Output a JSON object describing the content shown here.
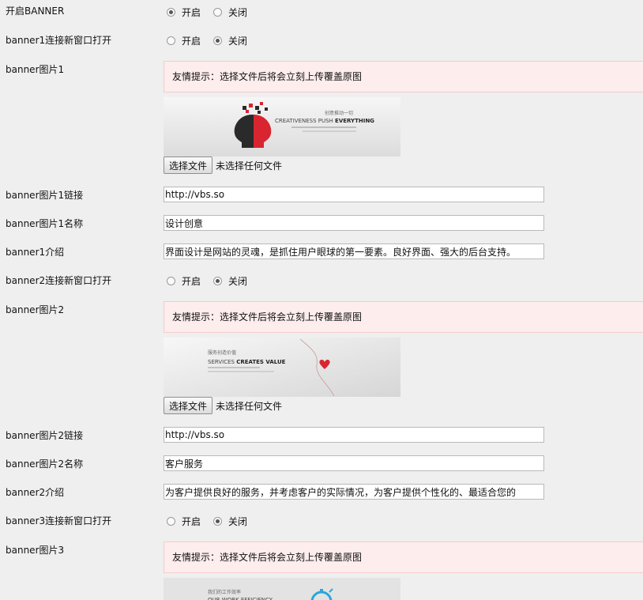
{
  "banner_toggle": {
    "label": "开启BANNER",
    "options": [
      "开启",
      "关闭"
    ],
    "selected": "开启"
  },
  "notice_text": "友情提示：选择文件后将会立刻上传覆盖原图",
  "file_picker": {
    "button": "选择文件",
    "status": "未选择任何文件"
  },
  "banners": [
    {
      "new_window": {
        "label": "banner1连接新窗口打开",
        "options": [
          "开启",
          "关闭"
        ],
        "selected": "关闭"
      },
      "image_label": "banner图片1",
      "image_text": {
        "cn": "创意推动一切",
        "en_a": "CREATIVENESS PUSH ",
        "en_b": "EVERYTHING"
      },
      "link": {
        "label": "banner图片1链接",
        "value": "http://vbs.so"
      },
      "name": {
        "label": "banner图片1名称",
        "value": "设计创意"
      },
      "intro": {
        "label": "banner1介绍",
        "value": "界面设计是网站的灵魂，是抓住用户眼球的第一要素。良好界面、强大的后台支持。"
      }
    },
    {
      "new_window": {
        "label": "banner2连接新窗口打开",
        "options": [
          "开启",
          "关闭"
        ],
        "selected": "关闭"
      },
      "image_label": "banner图片2",
      "image_text": {
        "cn": "服务创造价值",
        "en_a": "SERVICES ",
        "en_b": "CREATES VALUE"
      },
      "link": {
        "label": "banner图片2链接",
        "value": "http://vbs.so"
      },
      "name": {
        "label": "banner图片2名称",
        "value": "客户服务"
      },
      "intro": {
        "label": "banner2介绍",
        "value": "为客户提供良好的服务，并考虑客户的实际情况，为客户提供个性化的、最适合您的"
      }
    },
    {
      "new_window": {
        "label": "banner3连接新窗口打开",
        "options": [
          "开启",
          "关闭"
        ],
        "selected": "关闭"
      },
      "image_label": "banner图片3",
      "image_text": {
        "cn": "我们的工作效率",
        "en_a": "OUR WORK EFFICIENCY",
        "en_b": ""
      }
    }
  ],
  "colors": {
    "page_bg": "#efefef",
    "notice_bg": "#fdeded",
    "notice_border": "#f2cccc",
    "heart_red": "#d9252f"
  }
}
